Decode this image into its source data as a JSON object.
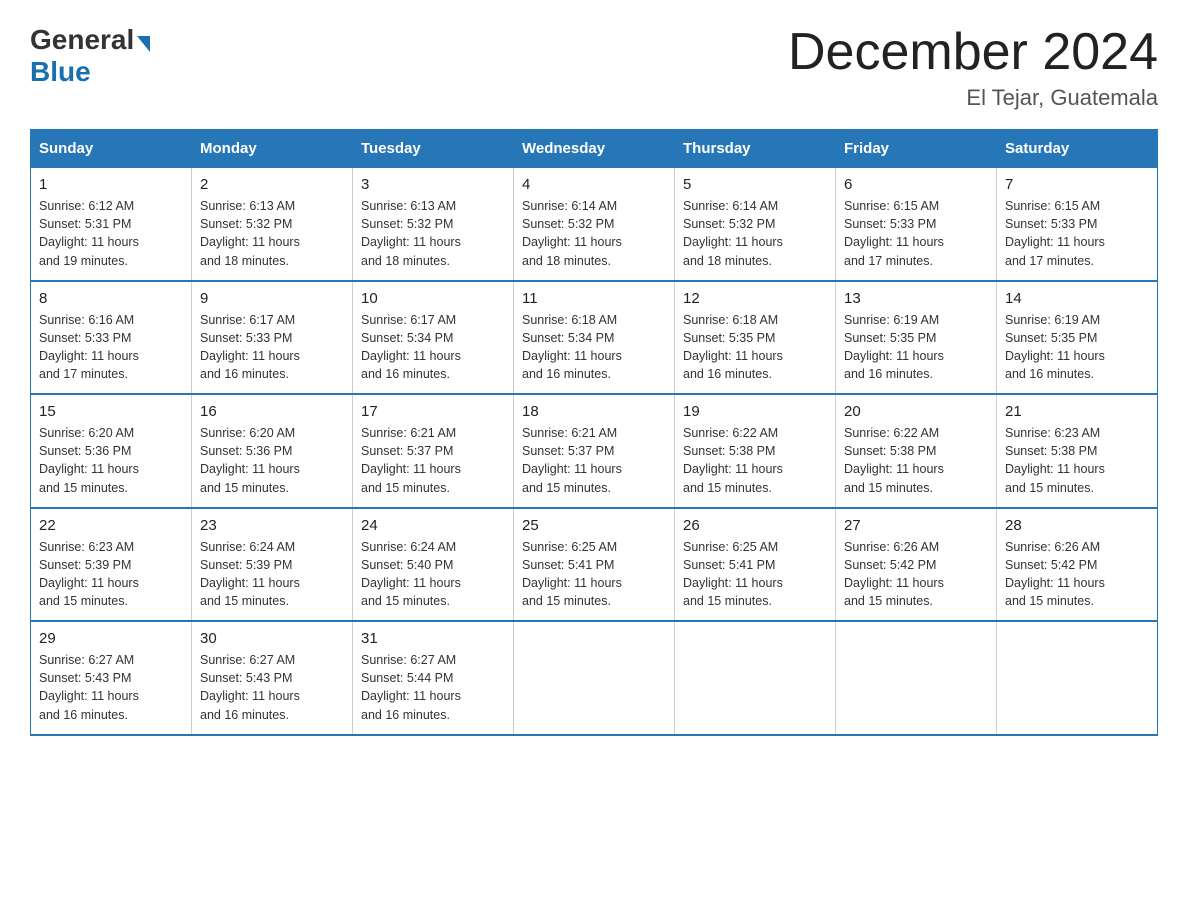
{
  "logo": {
    "general": "General",
    "blue": "Blue",
    "arrow": "▶"
  },
  "title": "December 2024",
  "location": "El Tejar, Guatemala",
  "days_of_week": [
    "Sunday",
    "Monday",
    "Tuesday",
    "Wednesday",
    "Thursday",
    "Friday",
    "Saturday"
  ],
  "weeks": [
    [
      {
        "day": "1",
        "sunrise": "6:12 AM",
        "sunset": "5:31 PM",
        "daylight": "11 hours and 19 minutes."
      },
      {
        "day": "2",
        "sunrise": "6:13 AM",
        "sunset": "5:32 PM",
        "daylight": "11 hours and 18 minutes."
      },
      {
        "day": "3",
        "sunrise": "6:13 AM",
        "sunset": "5:32 PM",
        "daylight": "11 hours and 18 minutes."
      },
      {
        "day": "4",
        "sunrise": "6:14 AM",
        "sunset": "5:32 PM",
        "daylight": "11 hours and 18 minutes."
      },
      {
        "day": "5",
        "sunrise": "6:14 AM",
        "sunset": "5:32 PM",
        "daylight": "11 hours and 18 minutes."
      },
      {
        "day": "6",
        "sunrise": "6:15 AM",
        "sunset": "5:33 PM",
        "daylight": "11 hours and 17 minutes."
      },
      {
        "day": "7",
        "sunrise": "6:15 AM",
        "sunset": "5:33 PM",
        "daylight": "11 hours and 17 minutes."
      }
    ],
    [
      {
        "day": "8",
        "sunrise": "6:16 AM",
        "sunset": "5:33 PM",
        "daylight": "11 hours and 17 minutes."
      },
      {
        "day": "9",
        "sunrise": "6:17 AM",
        "sunset": "5:33 PM",
        "daylight": "11 hours and 16 minutes."
      },
      {
        "day": "10",
        "sunrise": "6:17 AM",
        "sunset": "5:34 PM",
        "daylight": "11 hours and 16 minutes."
      },
      {
        "day": "11",
        "sunrise": "6:18 AM",
        "sunset": "5:34 PM",
        "daylight": "11 hours and 16 minutes."
      },
      {
        "day": "12",
        "sunrise": "6:18 AM",
        "sunset": "5:35 PM",
        "daylight": "11 hours and 16 minutes."
      },
      {
        "day": "13",
        "sunrise": "6:19 AM",
        "sunset": "5:35 PM",
        "daylight": "11 hours and 16 minutes."
      },
      {
        "day": "14",
        "sunrise": "6:19 AM",
        "sunset": "5:35 PM",
        "daylight": "11 hours and 16 minutes."
      }
    ],
    [
      {
        "day": "15",
        "sunrise": "6:20 AM",
        "sunset": "5:36 PM",
        "daylight": "11 hours and 15 minutes."
      },
      {
        "day": "16",
        "sunrise": "6:20 AM",
        "sunset": "5:36 PM",
        "daylight": "11 hours and 15 minutes."
      },
      {
        "day": "17",
        "sunrise": "6:21 AM",
        "sunset": "5:37 PM",
        "daylight": "11 hours and 15 minutes."
      },
      {
        "day": "18",
        "sunrise": "6:21 AM",
        "sunset": "5:37 PM",
        "daylight": "11 hours and 15 minutes."
      },
      {
        "day": "19",
        "sunrise": "6:22 AM",
        "sunset": "5:38 PM",
        "daylight": "11 hours and 15 minutes."
      },
      {
        "day": "20",
        "sunrise": "6:22 AM",
        "sunset": "5:38 PM",
        "daylight": "11 hours and 15 minutes."
      },
      {
        "day": "21",
        "sunrise": "6:23 AM",
        "sunset": "5:38 PM",
        "daylight": "11 hours and 15 minutes."
      }
    ],
    [
      {
        "day": "22",
        "sunrise": "6:23 AM",
        "sunset": "5:39 PM",
        "daylight": "11 hours and 15 minutes."
      },
      {
        "day": "23",
        "sunrise": "6:24 AM",
        "sunset": "5:39 PM",
        "daylight": "11 hours and 15 minutes."
      },
      {
        "day": "24",
        "sunrise": "6:24 AM",
        "sunset": "5:40 PM",
        "daylight": "11 hours and 15 minutes."
      },
      {
        "day": "25",
        "sunrise": "6:25 AM",
        "sunset": "5:41 PM",
        "daylight": "11 hours and 15 minutes."
      },
      {
        "day": "26",
        "sunrise": "6:25 AM",
        "sunset": "5:41 PM",
        "daylight": "11 hours and 15 minutes."
      },
      {
        "day": "27",
        "sunrise": "6:26 AM",
        "sunset": "5:42 PM",
        "daylight": "11 hours and 15 minutes."
      },
      {
        "day": "28",
        "sunrise": "6:26 AM",
        "sunset": "5:42 PM",
        "daylight": "11 hours and 15 minutes."
      }
    ],
    [
      {
        "day": "29",
        "sunrise": "6:27 AM",
        "sunset": "5:43 PM",
        "daylight": "11 hours and 16 minutes."
      },
      {
        "day": "30",
        "sunrise": "6:27 AM",
        "sunset": "5:43 PM",
        "daylight": "11 hours and 16 minutes."
      },
      {
        "day": "31",
        "sunrise": "6:27 AM",
        "sunset": "5:44 PM",
        "daylight": "11 hours and 16 minutes."
      },
      null,
      null,
      null,
      null
    ]
  ],
  "labels": {
    "sunrise": "Sunrise:",
    "sunset": "Sunset:",
    "daylight": "Daylight:"
  }
}
